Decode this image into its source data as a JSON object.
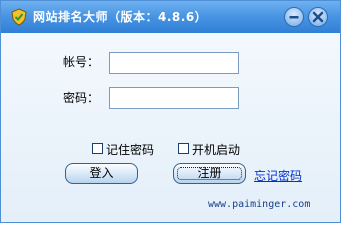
{
  "window": {
    "title": "网站排名大师（版本：4.8.6）",
    "icon": "shield-icon",
    "minimize_icon": "minimize-icon",
    "close_icon": "close-icon"
  },
  "form": {
    "account_label": "帐号：",
    "account_value": "",
    "password_label": "密码：",
    "password_value": "",
    "remember_password_label": "记住密码",
    "remember_password_checked": false,
    "autostart_label": "开机启动",
    "autostart_checked": false
  },
  "buttons": {
    "login_label": "登入",
    "register_label": "注册",
    "forgot_password_label": "忘记密码"
  },
  "footer": {
    "website": "www.paiminger.com"
  },
  "colors": {
    "titlebar": "#4a96e3",
    "background": "#e9f3fc",
    "link": "#0033cc"
  }
}
